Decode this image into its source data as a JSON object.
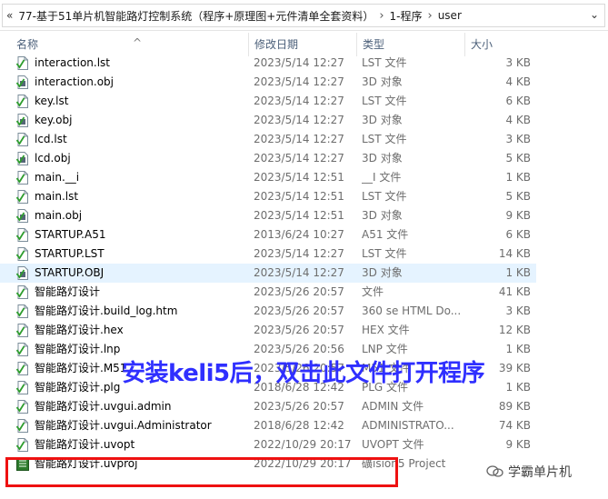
{
  "address": {
    "back": "«",
    "segments": [
      "77-基于51单片机智能路灯控制系统（程序+原理图+元件清单全套资料）",
      "1-程序",
      "user"
    ],
    "separator": "›",
    "dropdown": "⌄"
  },
  "columns": {
    "name": "名称",
    "date": "修改日期",
    "type": "类型",
    "size": "大小",
    "sort_indicator": "^"
  },
  "files": [
    {
      "name": "interaction.lst",
      "date": "2023/5/14 12:27",
      "type": "LST 文件",
      "size": "3 KB",
      "icon": "text-file-icon"
    },
    {
      "name": "interaction.obj",
      "date": "2023/5/14 12:27",
      "type": "3D 对象",
      "size": "4 KB",
      "icon": "object-file-icon"
    },
    {
      "name": "key.lst",
      "date": "2023/5/14 12:27",
      "type": "LST 文件",
      "size": "6 KB",
      "icon": "text-file-icon"
    },
    {
      "name": "key.obj",
      "date": "2023/5/14 12:27",
      "type": "3D 对象",
      "size": "4 KB",
      "icon": "object-file-icon"
    },
    {
      "name": "lcd.lst",
      "date": "2023/5/14 12:27",
      "type": "LST 文件",
      "size": "3 KB",
      "icon": "text-file-icon"
    },
    {
      "name": "lcd.obj",
      "date": "2023/5/14 12:27",
      "type": "3D 对象",
      "size": "5 KB",
      "icon": "object-file-icon"
    },
    {
      "name": "main.__i",
      "date": "2023/5/14 12:51",
      "type": "__I 文件",
      "size": "1 KB",
      "icon": "text-file-icon"
    },
    {
      "name": "main.lst",
      "date": "2023/5/14 12:51",
      "type": "LST 文件",
      "size": "5 KB",
      "icon": "text-file-icon"
    },
    {
      "name": "main.obj",
      "date": "2023/5/14 12:51",
      "type": "3D 对象",
      "size": "9 KB",
      "icon": "object-file-icon"
    },
    {
      "name": "STARTUP.A51",
      "date": "2013/6/24 10:27",
      "type": "A51 文件",
      "size": "6 KB",
      "icon": "text-file-icon"
    },
    {
      "name": "STARTUP.LST",
      "date": "2023/5/14 12:27",
      "type": "LST 文件",
      "size": "14 KB",
      "icon": "text-file-icon"
    },
    {
      "name": "STARTUP.OBJ",
      "date": "2023/5/14 12:27",
      "type": "3D 对象",
      "size": "1 KB",
      "icon": "object-file-icon",
      "selected": true
    },
    {
      "name": "智能路灯设计",
      "date": "2023/5/26 20:57",
      "type": "文件",
      "size": "41 KB",
      "icon": "text-file-icon"
    },
    {
      "name": "智能路灯设计.build_log.htm",
      "date": "2023/5/26 20:57",
      "type": "360 se HTML Do...",
      "size": "3 KB",
      "icon": "text-file-icon"
    },
    {
      "name": "智能路灯设计.hex",
      "date": "2023/5/26 20:57",
      "type": "HEX 文件",
      "size": "12 KB",
      "icon": "text-file-icon"
    },
    {
      "name": "智能路灯设计.lnp",
      "date": "2023/5/26 20:56",
      "type": "LNP 文件",
      "size": "1 KB",
      "icon": "text-file-icon"
    },
    {
      "name": "智能路灯设计.M51",
      "date": "2023/5/26 20:57",
      "type": "M51 文件",
      "size": "39 KB",
      "icon": "text-file-icon"
    },
    {
      "name": "智能路灯设计.plg",
      "date": "2018/6/28 12:42",
      "type": "PLG 文件",
      "size": "1 KB",
      "icon": "text-file-icon"
    },
    {
      "name": "智能路灯设计.uvgui.admin",
      "date": "2023/5/26 20:57",
      "type": "ADMIN 文件",
      "size": "89 KB",
      "icon": "text-file-icon"
    },
    {
      "name": "智能路灯设计.uvgui.Administrator",
      "date": "2018/6/28 12:42",
      "type": "ADMINISTRATO...",
      "size": "74 KB",
      "icon": "text-file-icon"
    },
    {
      "name": "智能路灯设计.uvopt",
      "date": "2022/10/29 20:17",
      "type": "UVOPT 文件",
      "size": "9 KB",
      "icon": "text-file-icon"
    },
    {
      "name": "智能路灯设计.uvproj",
      "date": "2022/10/29 20:17",
      "type": "礦ision5 Project",
      "size": "",
      "icon": "keil-project-icon"
    }
  ],
  "overlay_text": "安装keli5后，双击此文件打开程序",
  "watermark": {
    "text": "学霸单片机",
    "icon": "wechat-icon"
  },
  "colors": {
    "selected_bg": "#e5f3ff",
    "overlay": "#2f2fff",
    "highlight_box": "#ee1111"
  }
}
